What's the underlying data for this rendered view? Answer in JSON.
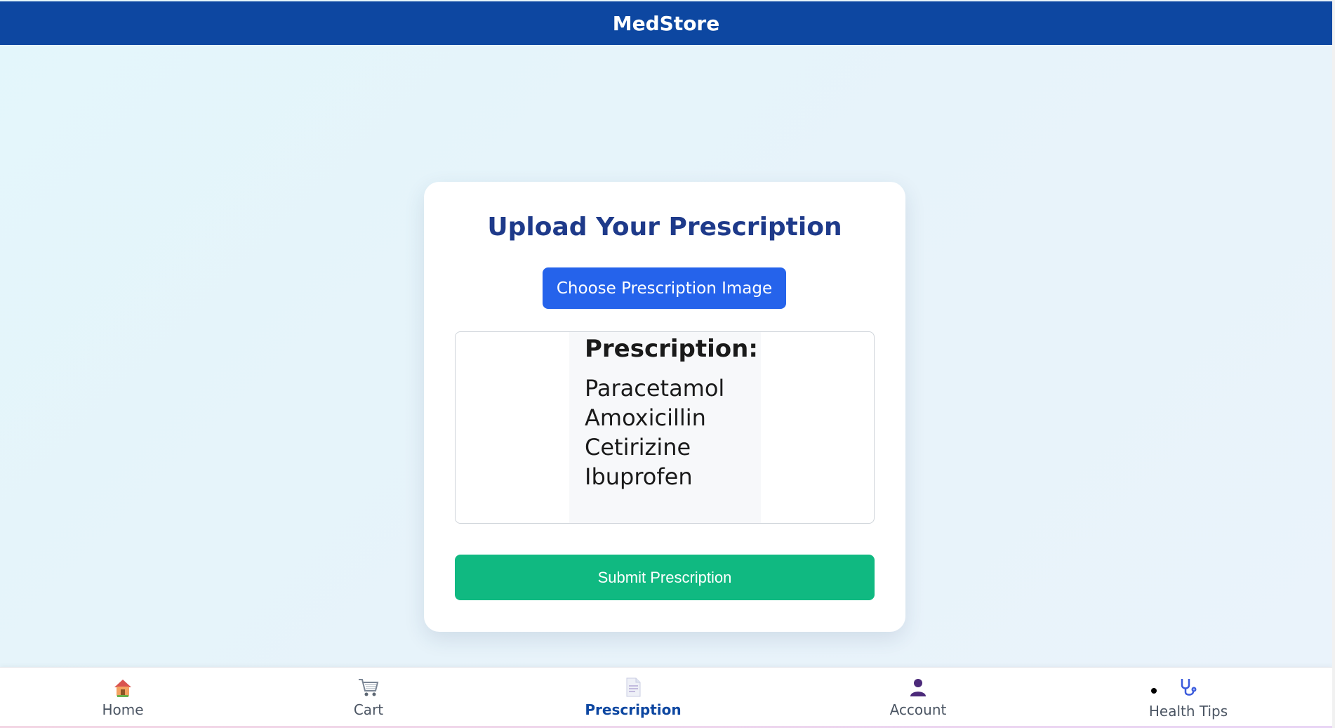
{
  "header": {
    "title": "MedStore"
  },
  "upload_card": {
    "title": "Upload Your Prescription",
    "choose_button_label": "Choose Prescription Image",
    "preview": {
      "heading": "Prescription:",
      "medicines": [
        "Paracetamol",
        "Amoxicillin",
        "Cetirizine",
        "Ibuprofen"
      ]
    },
    "submit_button_label": "Submit Prescription"
  },
  "bottom_nav": {
    "items": [
      {
        "label": "Home",
        "icon": "house-icon"
      },
      {
        "label": "Cart",
        "icon": "shopping-cart-icon"
      },
      {
        "label": "Prescription",
        "icon": "document-icon",
        "active": true
      },
      {
        "label": "Account",
        "icon": "user-icon"
      },
      {
        "label": "Health Tips",
        "icon": "stethoscope-icon"
      }
    ]
  },
  "colors": {
    "header_bg": "#0d47a1",
    "title_text": "#1e3a8a",
    "choose_button_bg": "#2563eb",
    "submit_button_bg": "#10b981",
    "active_nav": "#0d47a1"
  }
}
